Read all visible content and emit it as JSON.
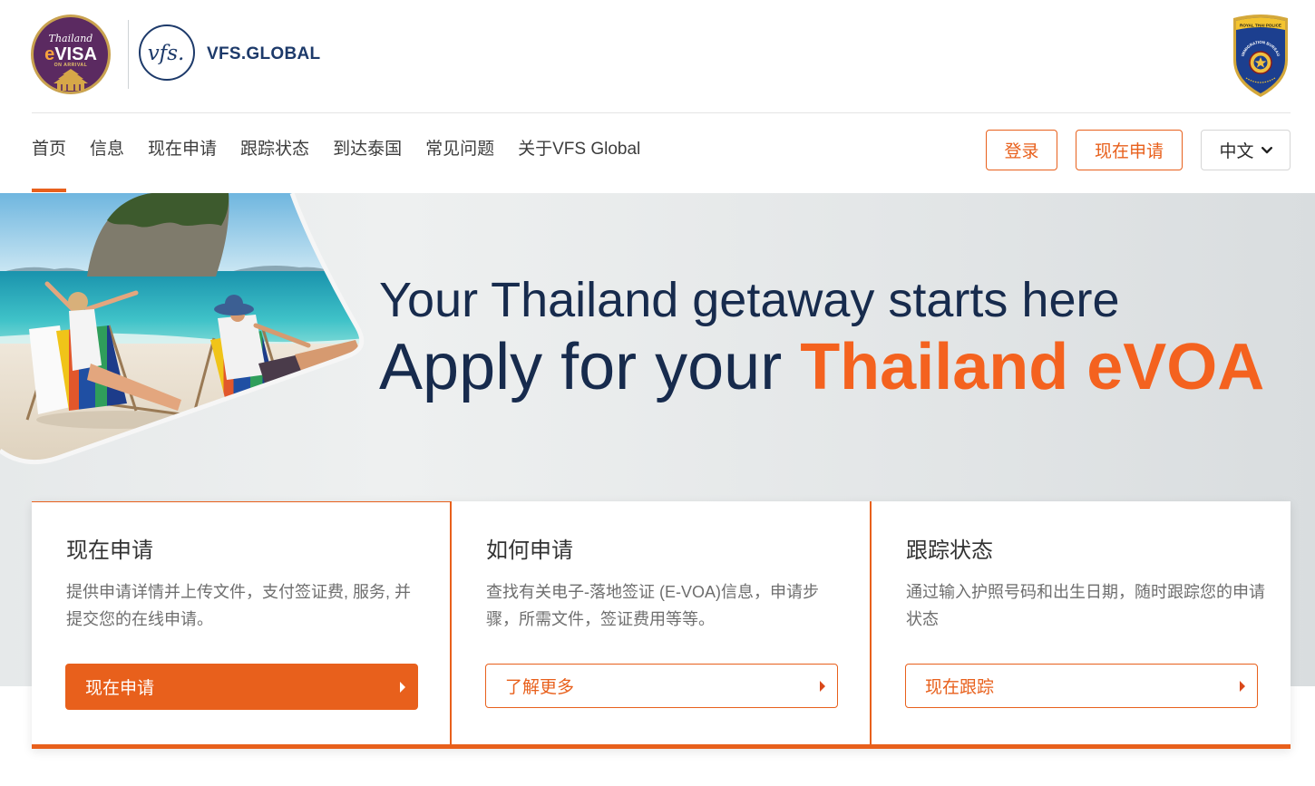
{
  "logos": {
    "evisa": {
      "script": "Thailand",
      "e": "e",
      "visa": "VISA",
      "tagline": "ON ARRIVAL"
    },
    "vfs": {
      "monogram": "vfs.",
      "wordmark": "VFS.GLOBAL"
    },
    "police": {
      "top": "ROYAL THAI POLICE",
      "arc": "IMMIGRATION BUREAU"
    }
  },
  "nav": {
    "items": [
      {
        "label": "首页",
        "active": true
      },
      {
        "label": "信息",
        "active": false
      },
      {
        "label": "现在申请",
        "active": false
      },
      {
        "label": "跟踪状态",
        "active": false
      },
      {
        "label": "到达泰国",
        "active": false
      },
      {
        "label": "常见问题",
        "active": false
      },
      {
        "label": "关于VFS Global",
        "active": false
      }
    ]
  },
  "actions": {
    "login": "登录",
    "apply": "现在申请",
    "language": "中文"
  },
  "hero": {
    "line1": "Your Thailand getaway starts here",
    "line2_prefix": "Apply for your ",
    "line2_highlight": "Thailand eVOA"
  },
  "cards": [
    {
      "title": "现在申请",
      "description": "提供申请详情并上传文件，支付签证费, 服务, 并提交您的在线申请。",
      "button": "现在申请",
      "primary": true
    },
    {
      "title": "如何申请",
      "description": "查找有关电子-落地签证 (E-VOA)信息，申请步骤，所需文件，签证费用等等。",
      "button": "了解更多",
      "primary": false
    },
    {
      "title": "跟踪状态",
      "description": "通过输入护照号码和出生日期，随时跟踪您的申请状态",
      "button": "现在跟踪",
      "primary": false
    }
  ],
  "icons": {
    "card_button": "caret-right-icon",
    "language_toggle": "chevron-down-icon"
  },
  "colors": {
    "accent": "#e8601c",
    "heading_navy": "#172b4d",
    "highlight_orange": "#f4621f"
  }
}
